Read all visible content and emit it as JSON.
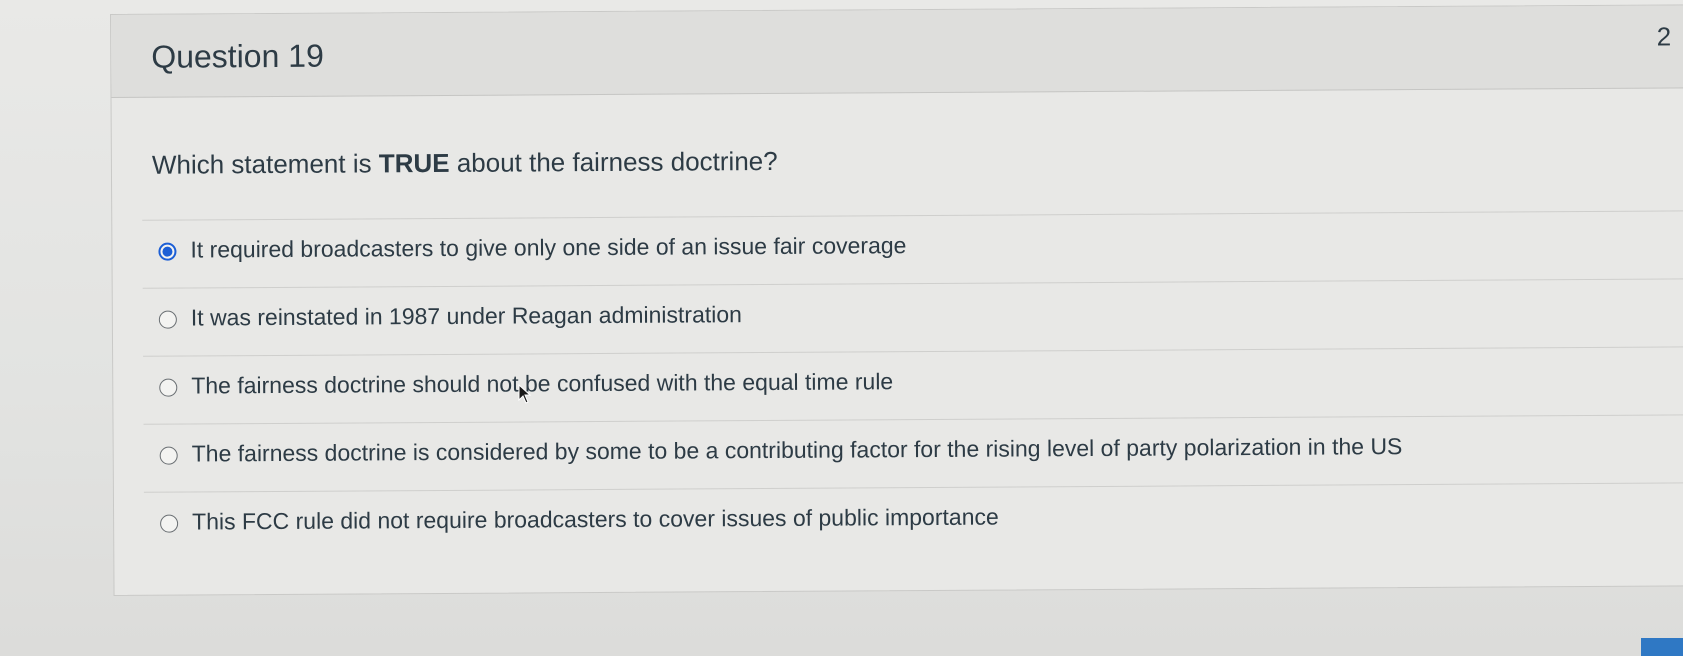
{
  "header": {
    "title": "Question 19",
    "points": "2"
  },
  "question": {
    "prefix": "Which statement is ",
    "emphasis": "TRUE",
    "suffix": " about the fairness doctrine?"
  },
  "answers": [
    {
      "label": "It required broadcasters to give only one side of an issue fair coverage",
      "selected": true
    },
    {
      "label": "It was reinstated in 1987 under Reagan administration",
      "selected": false
    },
    {
      "label": "The fairness doctrine should not be confused with the equal time rule",
      "selected": false
    },
    {
      "label": "The fairness doctrine is considered by some to be a contributing factor for the rising level of party polarization in the US",
      "selected": false
    },
    {
      "label": "This FCC rule did not require broadcasters to cover issues of public importance",
      "selected": false
    }
  ],
  "colors": {
    "accent": "#1c5fd6",
    "text": "#2d3b45"
  }
}
